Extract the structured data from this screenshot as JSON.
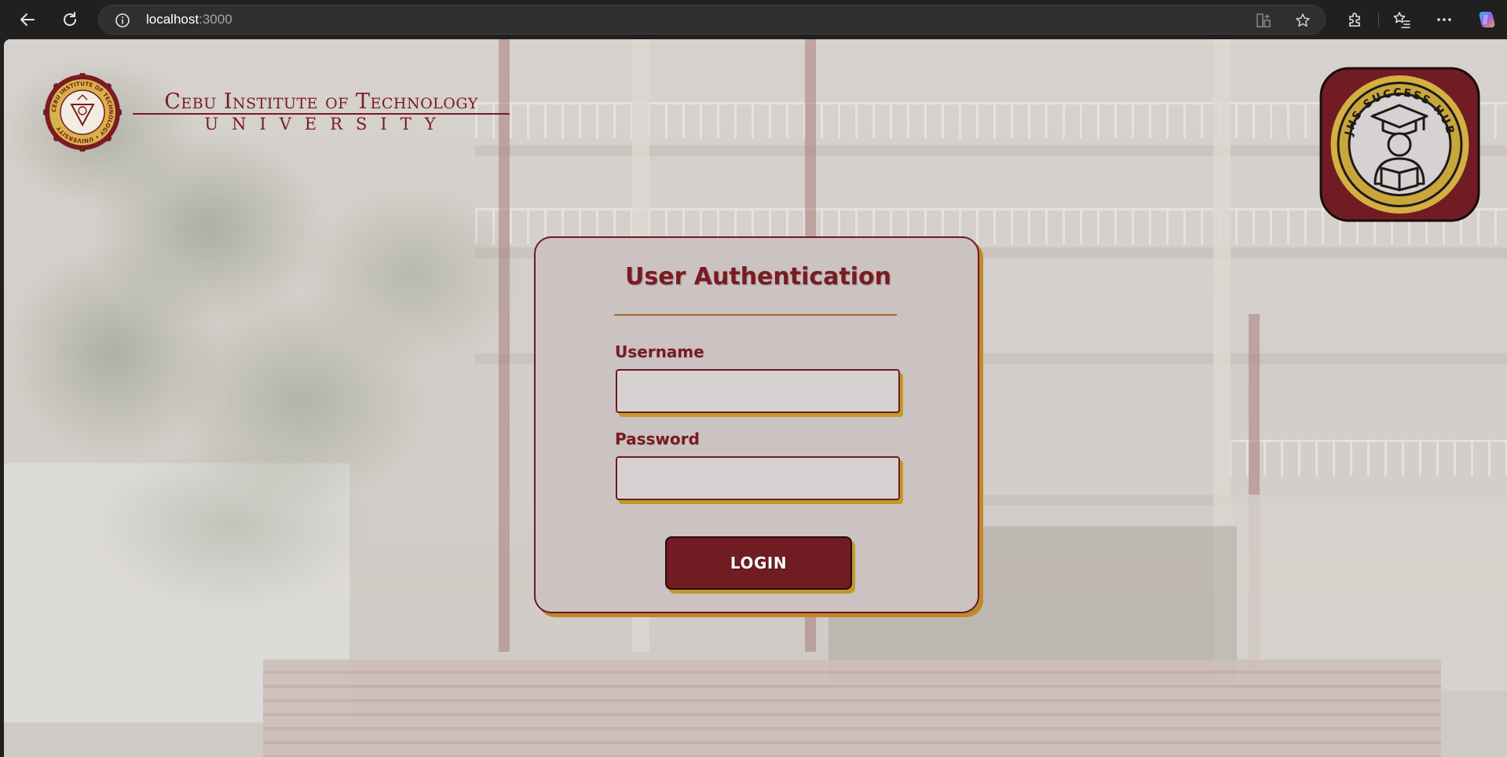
{
  "browser": {
    "url_host": "localhost",
    "url_port": ":3000"
  },
  "header": {
    "university_line1": "Cebu Institute of Technology",
    "university_line2": "UNIVERSITY",
    "seal_text": "CEBU INSTITUTE OF TECHNOLOGY • UNIVERSITY",
    "hub_text": "JHS SUCCESS HUB"
  },
  "login": {
    "title": "User Authentication",
    "username_label": "Username",
    "username_value": "",
    "password_label": "Password",
    "password_value": "",
    "button_label": "LOGIN"
  },
  "colors": {
    "maroon": "#701c22",
    "gold": "#c39a28",
    "card_bg": "#cbc2c2"
  }
}
